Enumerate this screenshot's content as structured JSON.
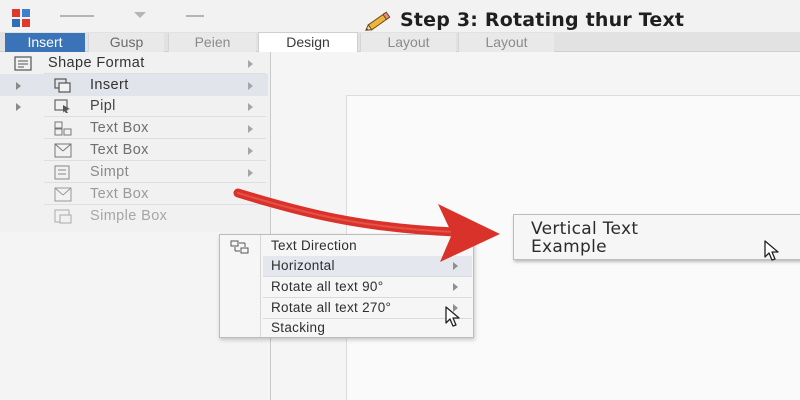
{
  "window": {
    "title": "Step 3: Rotating thur Text",
    "logo_colors": [
      "#e0392b",
      "#3f7fd0",
      "#2f6fb6",
      "#e0392b"
    ]
  },
  "tabs": [
    {
      "label": "Insert",
      "state": "active"
    },
    {
      "label": "Gusp",
      "state": "normal"
    },
    {
      "label": "Peien",
      "state": "normal"
    },
    {
      "label": "Design",
      "state": "selected"
    },
    {
      "label": "Layout",
      "state": "normal"
    },
    {
      "label": "Layout",
      "state": "normal"
    }
  ],
  "menu": {
    "items": [
      {
        "label": "Shape Format",
        "icon": "shape-format-icon"
      },
      {
        "label": "Insert",
        "icon": "insert-icon"
      },
      {
        "label": "Pipl",
        "icon": "pipl-icon"
      },
      {
        "label": "Text Box",
        "icon": "text-box-icon"
      },
      {
        "label": "Text Box",
        "icon": "text-box-icon"
      },
      {
        "label": "Simpt",
        "icon": "simpt-icon"
      },
      {
        "label": "Text Box",
        "icon": "text-box-icon"
      },
      {
        "label": "Simple Box",
        "icon": "simple-box-icon"
      }
    ]
  },
  "submenu": {
    "items": [
      {
        "label": "Text Direction"
      },
      {
        "label": "Horizontal"
      },
      {
        "label": "Rotate all text 90°"
      },
      {
        "label": "Rotate all text 270°"
      },
      {
        "label": "Stacking"
      }
    ]
  },
  "document": {
    "textbox_line1": "Vertical Text",
    "textbox_line2": "Example"
  },
  "annotation": {
    "arrow_color": "#d9322a"
  }
}
